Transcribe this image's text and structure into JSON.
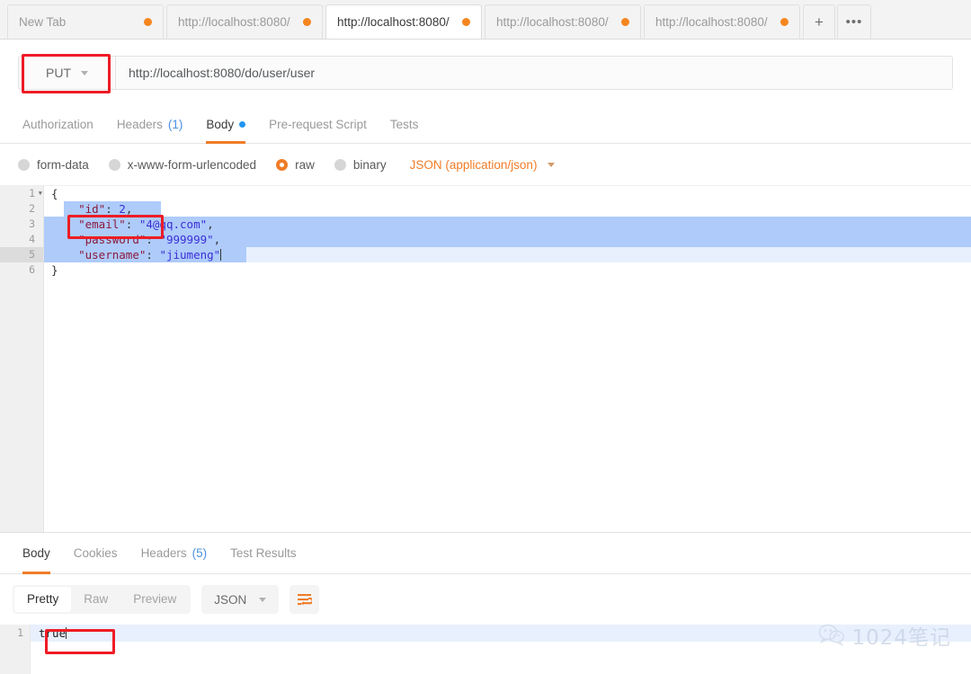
{
  "tabbar": {
    "tabs": [
      {
        "label": "New Tab",
        "active": false,
        "unsaved": true
      },
      {
        "label": "http://localhost:8080/",
        "active": false,
        "unsaved": true
      },
      {
        "label": "http://localhost:8080/",
        "active": true,
        "unsaved": true
      },
      {
        "label": "http://localhost:8080/",
        "active": false,
        "unsaved": true
      },
      {
        "label": "http://localhost:8080/",
        "active": false,
        "unsaved": true
      }
    ],
    "new_tab_label": "+",
    "more_label": "•••"
  },
  "request": {
    "method": "PUT",
    "url": "http://localhost:8080/do/user/user",
    "tabs": [
      {
        "label": "Authorization",
        "count": "",
        "active": false,
        "dot": false
      },
      {
        "label": "Headers",
        "count": "(1)",
        "active": false,
        "dot": false
      },
      {
        "label": "Body",
        "count": "",
        "active": true,
        "dot": true
      },
      {
        "label": "Pre-request Script",
        "count": "",
        "active": false,
        "dot": false
      },
      {
        "label": "Tests",
        "count": "",
        "active": false,
        "dot": false
      }
    ],
    "body_types": [
      {
        "label": "form-data",
        "selected": false
      },
      {
        "label": "x-www-form-urlencoded",
        "selected": false
      },
      {
        "label": "raw",
        "selected": true
      },
      {
        "label": "binary",
        "selected": false
      }
    ],
    "content_type": "JSON (application/json)",
    "body_lines": [
      {
        "num": "1",
        "text": "{",
        "fold": true,
        "selected": false,
        "active": false
      },
      {
        "num": "2",
        "text": "    \"id\": 2,",
        "fold": false,
        "selected": true,
        "active": false
      },
      {
        "num": "3",
        "text": "    \"email\": \"4@qq.com\",",
        "fold": false,
        "selected": true,
        "active": false
      },
      {
        "num": "4",
        "text": "    \"password\": \"999999\",",
        "fold": false,
        "selected": true,
        "active": false
      },
      {
        "num": "5",
        "text": "    \"username\": \"jiumeng\"",
        "fold": false,
        "selected": true,
        "active": true
      },
      {
        "num": "6",
        "text": "}",
        "fold": false,
        "selected": false,
        "active": false
      }
    ]
  },
  "response": {
    "tabs": [
      {
        "label": "Body",
        "count": "",
        "active": true
      },
      {
        "label": "Cookies",
        "count": "",
        "active": false
      },
      {
        "label": "Headers",
        "count": "(5)",
        "active": false
      },
      {
        "label": "Test Results",
        "count": "",
        "active": false
      }
    ],
    "view_modes": [
      {
        "label": "Pretty",
        "active": true
      },
      {
        "label": "Raw",
        "active": false
      },
      {
        "label": "Preview",
        "active": false
      }
    ],
    "format": "JSON",
    "wrap_icon": "word-wrap-icon",
    "body_lines": [
      {
        "num": "1",
        "text": "true",
        "active": true
      }
    ]
  },
  "watermark": {
    "icon": "wechat-icon",
    "text": "1024笔记"
  },
  "colors": {
    "accent": "#f07c28",
    "annotation": "#ee1c25",
    "tab_dot": "#f5861f",
    "link_blue": "#4a90e2",
    "selection": "#aecbfa"
  }
}
